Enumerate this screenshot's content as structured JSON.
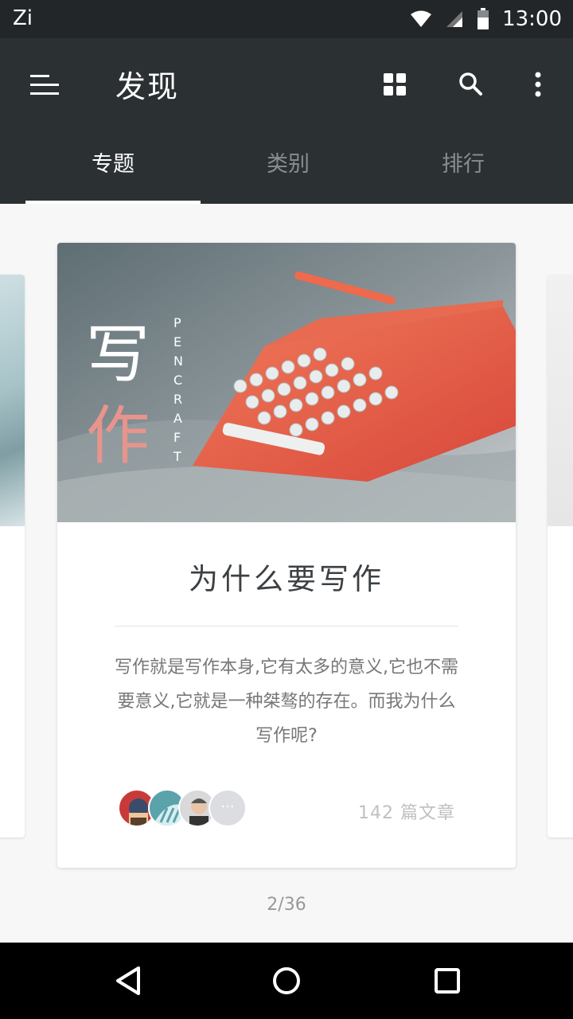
{
  "status": {
    "carrier": "Zi",
    "time": "13:00"
  },
  "header": {
    "title": "发现",
    "icons": [
      "menu-icon",
      "grid-icon",
      "search-icon",
      "more-vert-icon"
    ]
  },
  "tabs": [
    {
      "label": "专题",
      "active": true
    },
    {
      "label": "类别",
      "active": false
    },
    {
      "label": "排行",
      "active": false
    }
  ],
  "card": {
    "hero": {
      "big_char_1": "写",
      "big_char_2": "作",
      "vertical_text": "PENCRAFT"
    },
    "title": "为什么要写作",
    "description": "写作就是写作本身,它有太多的意义,它也不需要意义,它就是一种桀骜的存在。而我为什么写作呢?",
    "more_avatars_label": "···",
    "article_count": "142 篇文章"
  },
  "pager": "2/36",
  "nav": {
    "icons": [
      "back-icon",
      "home-icon",
      "recents-icon"
    ]
  },
  "colors": {
    "app_bar": "#2b3033",
    "status_bar": "#222629",
    "accent_pink": "#e8948c"
  }
}
